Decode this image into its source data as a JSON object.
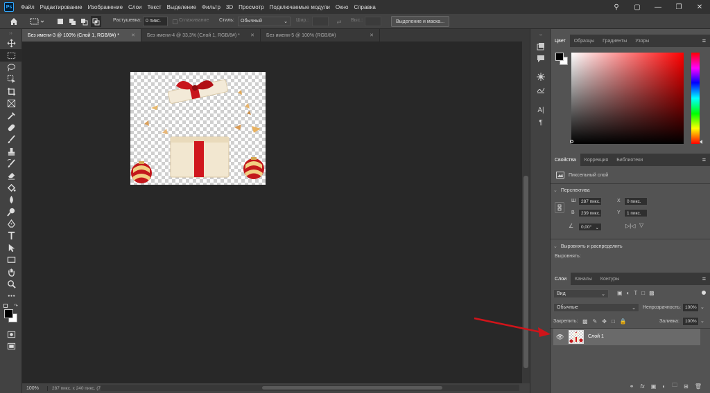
{
  "app": {
    "logo": "Ps"
  },
  "menu": [
    "Файл",
    "Редактирование",
    "Изображение",
    "Слои",
    "Текст",
    "Выделение",
    "Фильтр",
    "3D",
    "Просмотр",
    "Подключаемые модули",
    "Окно",
    "Справка"
  ],
  "options": {
    "feather_label": "Растушевка:",
    "feather_value": "0 пикс.",
    "antialias_label": "Сглаживание",
    "style_label": "Стиль:",
    "style_value": "Обычный",
    "width_label": "Шир.:",
    "height_label": "Выс.:",
    "mask_button": "Выделение и маска..."
  },
  "tabs": [
    {
      "label": "Без имени-3 @ 100% (Слой 1, RGB/8#) *",
      "active": true
    },
    {
      "label": "Без имени-4 @ 33,3% (Слой 1, RGB/8#) *",
      "active": false
    },
    {
      "label": "Без имени-5 @ 100% (RGB/8#)",
      "active": false
    }
  ],
  "status": {
    "zoom": "100%",
    "doc_info": "287 пикс. x 240 пикс. (72 ppi)"
  },
  "color_panel": {
    "tabs": [
      "Цвет",
      "Образцы",
      "Градиенты",
      "Узоры"
    ],
    "foreground": "#000000",
    "background": "#ffffff",
    "hue": "#ff0000"
  },
  "properties": {
    "tabs": [
      "Свойства",
      "Коррекция",
      "Библиотеки"
    ],
    "layer_type": "Пиксельный слой",
    "transform_title": "Перспектива",
    "w_label": "Ш",
    "w_value": "287 пикс.",
    "h_label": "В",
    "h_value": "239 пикс.",
    "x_label": "X",
    "x_value": "0 пикс.",
    "y_label": "Y",
    "y_value": "1 пикс.",
    "angle_value": "0,00°",
    "align_title": "Выровнять и распределить",
    "align_label": "Выровнять:"
  },
  "layers": {
    "tabs": [
      "Слои",
      "Каналы",
      "Контуры"
    ],
    "filter_value": "Вид",
    "blend_mode": "Обычные",
    "opacity_label": "Непрозрачность:",
    "opacity_value": "100%",
    "lock_label": "Закрепить:",
    "fill_label": "Заливка:",
    "fill_value": "100%",
    "items": [
      {
        "name": "Слой 1"
      }
    ],
    "footer_icons": [
      "link-icon",
      "fx-icon",
      "mask-icon",
      "adjustment-icon",
      "folder-icon",
      "new-layer-icon",
      "trash-icon"
    ]
  },
  "annotation": {
    "arrow_color": "#d0141a"
  }
}
